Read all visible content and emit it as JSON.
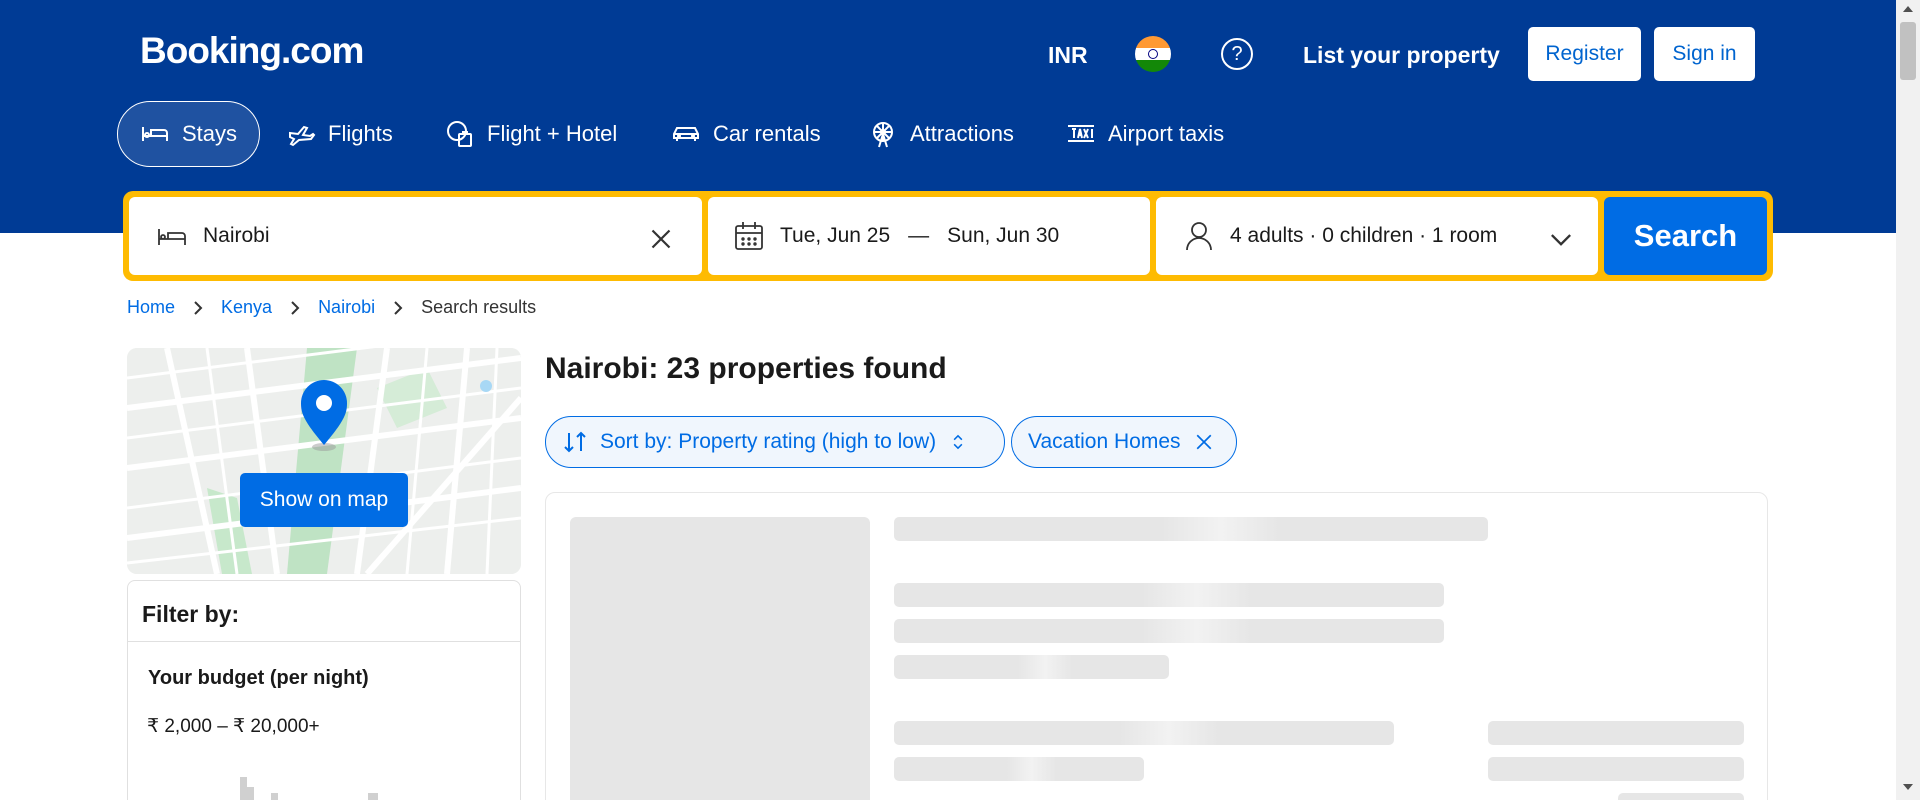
{
  "header": {
    "logo": "Booking.com",
    "currency": "INR",
    "flag_icon": "india-flag-icon",
    "list_property": "List your property",
    "register": "Register",
    "sign_in": "Sign in"
  },
  "nav": {
    "tabs": [
      {
        "label": "Stays",
        "icon": "bed-icon",
        "active": true
      },
      {
        "label": "Flights",
        "icon": "plane-icon"
      },
      {
        "label": "Flight + Hotel",
        "icon": "flight-hotel-icon"
      },
      {
        "label": "Car rentals",
        "icon": "car-icon"
      },
      {
        "label": "Attractions",
        "icon": "ferris-wheel-icon"
      },
      {
        "label": "Airport taxis",
        "icon": "taxi-icon"
      }
    ]
  },
  "search": {
    "destination": "Nairobi",
    "checkin": "Tue, Jun 25",
    "separator": "—",
    "checkout": "Sun, Jun 30",
    "occupancy": "4 adults · 0 children · 1 room",
    "button": "Search"
  },
  "breadcrumb": {
    "items": [
      "Home",
      "Kenya",
      "Nairobi"
    ],
    "current": "Search results"
  },
  "map": {
    "button": "Show on map"
  },
  "filter": {
    "title": "Filter by:",
    "budget_title": "Your budget (per night)",
    "budget_range": "₹ 2,000 – ₹ 20,000+"
  },
  "results": {
    "title": "Nairobi: 23 properties found",
    "sort_label": "Sort by: Property rating (high to low)",
    "active_filter": "Vacation Homes"
  },
  "colors": {
    "brand_blue": "#003b95",
    "action_blue": "#006ce4",
    "search_border": "#febb02"
  }
}
